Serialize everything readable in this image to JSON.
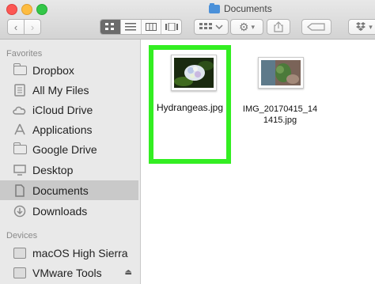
{
  "window": {
    "title": "Documents"
  },
  "toolbar": {
    "back_icon": "chevron-left-icon",
    "forward_icon": "chevron-right-icon",
    "view_modes": [
      "icon-view",
      "list-view",
      "column-view",
      "cover-flow-view"
    ],
    "active_view": "icon-view"
  },
  "sidebar": {
    "favorites_header": "Favorites",
    "favorites": [
      {
        "label": "Dropbox",
        "icon": "folder-icon"
      },
      {
        "label": "All My Files",
        "icon": "all-files-icon"
      },
      {
        "label": "iCloud Drive",
        "icon": "cloud-icon"
      },
      {
        "label": "Applications",
        "icon": "applications-icon"
      },
      {
        "label": "Google Drive",
        "icon": "folder-icon"
      },
      {
        "label": "Desktop",
        "icon": "desktop-icon"
      },
      {
        "label": "Documents",
        "icon": "documents-icon",
        "selected": true
      },
      {
        "label": "Downloads",
        "icon": "downloads-icon"
      }
    ],
    "devices_header": "Devices",
    "devices": [
      {
        "label": "macOS High Sierra",
        "icon": "disk-icon"
      },
      {
        "label": "VMware Tools",
        "icon": "disk-icon",
        "eject": true
      }
    ]
  },
  "files": [
    {
      "name": "Hydrangeas.jpg",
      "selected": true
    },
    {
      "name_line1": "IMG_20170415_14",
      "name_line2": "1415.jpg",
      "selected": false
    }
  ],
  "colors": {
    "selection_highlight": "#33ee22",
    "sidebar_selected": "#c9c9c9"
  }
}
